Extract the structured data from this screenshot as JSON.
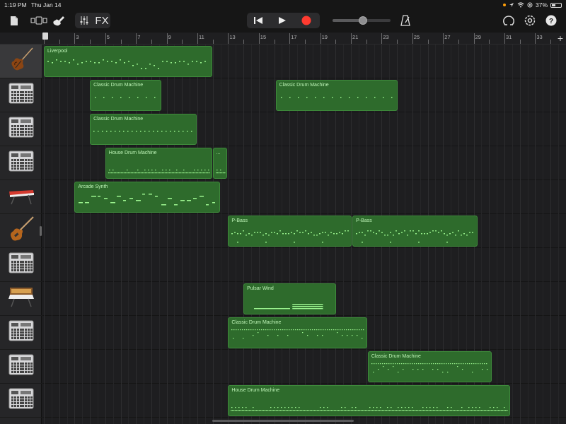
{
  "status_bar": {
    "time": "1:19 PM",
    "date": "Thu Jan 14",
    "battery_percent": "37%",
    "battery_level": 0.37
  },
  "toolbar": {
    "fx_label": "FX",
    "icons": [
      "document-icon",
      "tracks-view-icon",
      "instrument-icon",
      "mixer-icon",
      "rewind-icon",
      "play-icon",
      "record-icon",
      "metronome-icon",
      "loop-browser-icon",
      "settings-icon",
      "help-icon"
    ],
    "master_volume": 0.52,
    "record_color": "#ff3b30"
  },
  "ruler": {
    "labels": [
      "1",
      "3",
      "5",
      "7",
      "9",
      "11",
      "13",
      "15",
      "17",
      "19",
      "21",
      "23",
      "25",
      "27",
      "29",
      "31",
      "33"
    ],
    "add_label": "+"
  },
  "colors": {
    "region_fill": "#2e6b2c",
    "region_border": "#3e8a3b",
    "note_color": "#9cf58f"
  },
  "tracks": [
    {
      "instrument": "violin-icon",
      "selected": true
    },
    {
      "instrument": "drum-machine-icon",
      "selected": false
    },
    {
      "instrument": "drum-machine-icon",
      "selected": false
    },
    {
      "instrument": "drum-machine-icon",
      "selected": false
    },
    {
      "instrument": "synth-keyboard-icon",
      "selected": false
    },
    {
      "instrument": "bass-guitar-icon",
      "selected": false
    },
    {
      "instrument": "drum-machine-icon",
      "selected": false
    },
    {
      "instrument": "analog-synth-icon",
      "selected": false
    },
    {
      "instrument": "drum-machine-icon",
      "selected": false
    },
    {
      "instrument": "drum-machine-icon",
      "selected": false
    },
    {
      "instrument": "drum-machine-icon",
      "selected": false
    }
  ],
  "regions": [
    {
      "track": 0,
      "name": "Liverpool",
      "start_bar": 1,
      "end_bar": 12.0,
      "pattern": "melody"
    },
    {
      "track": 1,
      "name": "Classic Drum Machine",
      "start_bar": 4.0,
      "end_bar": 8.7,
      "pattern": "sparse"
    },
    {
      "track": 1,
      "name": "Classic Drum Machine",
      "start_bar": 16.1,
      "end_bar": 24.1,
      "pattern": "sparse"
    },
    {
      "track": 2,
      "name": "Classic Drum Machine",
      "start_bar": 4.0,
      "end_bar": 11.0,
      "pattern": "dots"
    },
    {
      "track": 3,
      "name": "House Drum Machine",
      "start_bar": 5.0,
      "end_bar": 12.0,
      "pattern": "dense"
    },
    {
      "track": 3,
      "name": "...",
      "start_bar": 12.0,
      "end_bar": 13.0,
      "pattern": "dense"
    },
    {
      "track": 4,
      "name": "Arcade Synth",
      "start_bar": 3.0,
      "end_bar": 12.5,
      "pattern": "synth"
    },
    {
      "track": 5,
      "name": "P-Bass",
      "start_bar": 13.0,
      "end_bar": 21.1,
      "pattern": "bass"
    },
    {
      "track": 5,
      "name": "P-Bass",
      "start_bar": 21.1,
      "end_bar": 29.3,
      "pattern": "bass"
    },
    {
      "track": 7,
      "name": "Pulsar Wind",
      "start_bar": 14.0,
      "end_bar": 20.1,
      "pattern": "pad"
    },
    {
      "track": 8,
      "name": "Classic Drum Machine",
      "start_bar": 13.0,
      "end_bar": 22.1,
      "pattern": "drum2"
    },
    {
      "track": 9,
      "name": "Classic Drum Machine",
      "start_bar": 22.1,
      "end_bar": 30.2,
      "pattern": "drum2"
    },
    {
      "track": 10,
      "name": "House Drum Machine",
      "start_bar": 13.0,
      "end_bar": 31.4,
      "pattern": "dense"
    }
  ]
}
